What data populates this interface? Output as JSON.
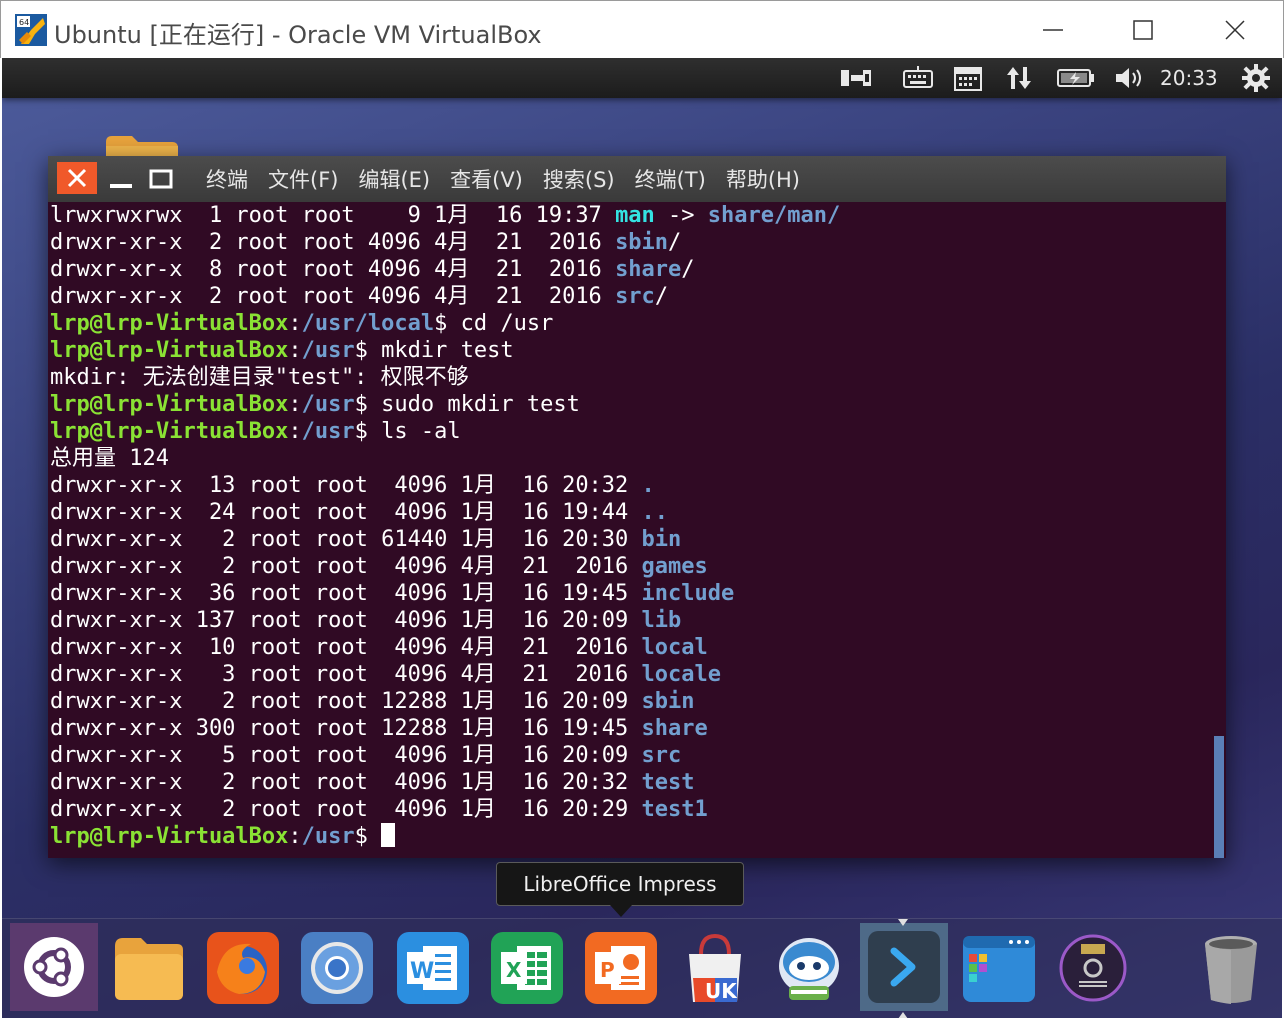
{
  "host": {
    "title": "Ubuntu [正在运行] - Oracle VM VirtualBox",
    "logo_badge": "64"
  },
  "panel": {
    "clock": "20:33",
    "tray_icons": [
      "network-wired-icon",
      "keyboard-icon",
      "calendar-icon",
      "transfer-icon",
      "battery-icon",
      "volume-icon",
      "gear-icon"
    ]
  },
  "terminal": {
    "menu": [
      "终端",
      "文件(F)",
      "编辑(E)",
      "查看(V)",
      "搜索(S)",
      "终端(T)",
      "帮助(H)"
    ],
    "lines": [
      {
        "parts": [
          {
            "t": "lrwxrwxrwx  1 root root    9 1月  16 19:37 "
          },
          {
            "t": "man",
            "c": "lnk"
          },
          {
            "t": " -> "
          },
          {
            "t": "share/man/",
            "c": "dir"
          }
        ]
      },
      {
        "parts": [
          {
            "t": "drwxr-xr-x  2 root root 4096 4月  21  2016 "
          },
          {
            "t": "sbin",
            "c": "dir"
          },
          {
            "t": "/"
          }
        ]
      },
      {
        "parts": [
          {
            "t": "drwxr-xr-x  8 root root 4096 4月  21  2016 "
          },
          {
            "t": "share",
            "c": "dir"
          },
          {
            "t": "/"
          }
        ]
      },
      {
        "parts": [
          {
            "t": "drwxr-xr-x  2 root root 4096 4月  21  2016 "
          },
          {
            "t": "src",
            "c": "dir"
          },
          {
            "t": "/"
          }
        ]
      },
      {
        "parts": [
          {
            "t": "lrp@lrp-VirtualBox",
            "c": "pr"
          },
          {
            "t": ":"
          },
          {
            "t": "/usr/local",
            "c": "pp"
          },
          {
            "t": "$ cd /usr"
          }
        ]
      },
      {
        "parts": [
          {
            "t": "lrp@lrp-VirtualBox",
            "c": "pr"
          },
          {
            "t": ":"
          },
          {
            "t": "/usr",
            "c": "pp"
          },
          {
            "t": "$ mkdir test"
          }
        ]
      },
      {
        "parts": [
          {
            "t": "mkdir: 无法创建目录\"test\": 权限不够"
          }
        ]
      },
      {
        "parts": [
          {
            "t": "lrp@lrp-VirtualBox",
            "c": "pr"
          },
          {
            "t": ":"
          },
          {
            "t": "/usr",
            "c": "pp"
          },
          {
            "t": "$ sudo mkdir test"
          }
        ]
      },
      {
        "parts": [
          {
            "t": "lrp@lrp-VirtualBox",
            "c": "pr"
          },
          {
            "t": ":"
          },
          {
            "t": "/usr",
            "c": "pp"
          },
          {
            "t": "$ ls -al"
          }
        ]
      },
      {
        "parts": [
          {
            "t": "总用量 124"
          }
        ]
      },
      {
        "parts": [
          {
            "t": "drwxr-xr-x  13 root root  4096 1月  16 20:32 "
          },
          {
            "t": ".",
            "c": "dir"
          }
        ]
      },
      {
        "parts": [
          {
            "t": "drwxr-xr-x  24 root root  4096 1月  16 19:44 "
          },
          {
            "t": "..",
            "c": "dir"
          }
        ]
      },
      {
        "parts": [
          {
            "t": "drwxr-xr-x   2 root root 61440 1月  16 20:30 "
          },
          {
            "t": "bin",
            "c": "dir"
          }
        ]
      },
      {
        "parts": [
          {
            "t": "drwxr-xr-x   2 root root  4096 4月  21  2016 "
          },
          {
            "t": "games",
            "c": "dir"
          }
        ]
      },
      {
        "parts": [
          {
            "t": "drwxr-xr-x  36 root root  4096 1月  16 19:45 "
          },
          {
            "t": "include",
            "c": "dir"
          }
        ]
      },
      {
        "parts": [
          {
            "t": "drwxr-xr-x 137 root root  4096 1月  16 20:09 "
          },
          {
            "t": "lib",
            "c": "dir"
          }
        ]
      },
      {
        "parts": [
          {
            "t": "drwxr-xr-x  10 root root  4096 4月  21  2016 "
          },
          {
            "t": "local",
            "c": "dir"
          }
        ]
      },
      {
        "parts": [
          {
            "t": "drwxr-xr-x   3 root root  4096 4月  21  2016 "
          },
          {
            "t": "locale",
            "c": "dir"
          }
        ]
      },
      {
        "parts": [
          {
            "t": "drwxr-xr-x   2 root root 12288 1月  16 20:09 "
          },
          {
            "t": "sbin",
            "c": "dir"
          }
        ]
      },
      {
        "parts": [
          {
            "t": "drwxr-xr-x 300 root root 12288 1月  16 19:45 "
          },
          {
            "t": "share",
            "c": "dir"
          }
        ]
      },
      {
        "parts": [
          {
            "t": "drwxr-xr-x   5 root root  4096 1月  16 20:09 "
          },
          {
            "t": "src",
            "c": "dir"
          }
        ]
      },
      {
        "parts": [
          {
            "t": "drwxr-xr-x   2 root root  4096 1月  16 20:32 "
          },
          {
            "t": "test",
            "c": "dir"
          }
        ]
      },
      {
        "parts": [
          {
            "t": "drwxr-xr-x   2 root root  4096 1月  16 20:29 "
          },
          {
            "t": "test1",
            "c": "dir"
          }
        ]
      },
      {
        "parts": [
          {
            "t": "lrp@lrp-VirtualBox",
            "c": "pr"
          },
          {
            "t": ":"
          },
          {
            "t": "/usr",
            "c": "pp"
          },
          {
            "t": "$ "
          }
        ],
        "cursor": true
      }
    ]
  },
  "tooltip": "LibreOffice Impress",
  "dock": {
    "items": [
      "ubuntu-launcher-icon",
      "files-folder-icon",
      "firefox-icon",
      "chromium-icon",
      "word-icon",
      "excel-icon",
      "powerpoint-icon",
      "software-center-icon",
      "mascot-app-icon",
      "terminal-app-icon",
      "workspace-switcher-icon",
      "dvd-disc-icon",
      "trash-icon"
    ],
    "ubuntu_software_badge": "UK"
  },
  "colors": {
    "terminal_bg": "#300a24",
    "prompt_user": "#8ae234",
    "prompt_path": "#729fcf",
    "symlink": "#34e2e2",
    "close_button": "#f0592a"
  }
}
